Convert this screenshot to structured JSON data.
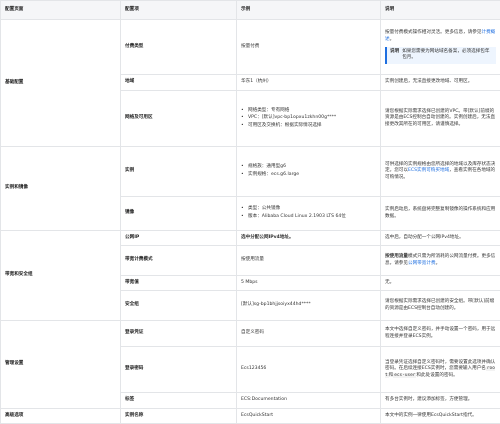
{
  "headers": [
    "配置页面",
    "配置项",
    "示例",
    "说明"
  ],
  "groups": {
    "basic": "基础配置",
    "instance_image": "实例和镜像",
    "bandwidth_security": "带宽和安全组",
    "management": "管理设置",
    "advanced": "高级选项"
  },
  "rows": {
    "billing": {
      "item": "付费类型",
      "example": "按量付费",
      "desc": "按量付费模式操作相对灵活。更多信息，请参见",
      "desc_link": "计费概述",
      "desc_tail": "。",
      "note_label": "说明",
      "note_text": "如果您需要为网站域名备案，必须选择包年包月。"
    },
    "region": {
      "item": "地域",
      "example": "华东1（杭州）",
      "desc": "实例创建后，无法直接更改地域、可用区。"
    },
    "network": {
      "item": "网络及可用区",
      "bullets": [
        "网络类型：专有网络",
        "VPC：[默认]vpc-bp1opxu1zkhn00g****",
        "可用区及交换机：根据实际情况选择"
      ],
      "desc": "请您根据实际需求选择已创建的VPC。带[默认]前缀的资源是由ECS控制台自动创建的。实例创建后，无法直接更改其所在的可用区，请谨慎选择。"
    },
    "instance": {
      "item": "实例",
      "bullets": [
        "规格族：通用型g6",
        "实例规格：ecs.g6.large"
      ],
      "desc_prefix": "可供选择的实例规格由您所选择的地域以及库存状态决定。您可以",
      "desc_link": "ECS实例可购买地域",
      "desc_tail": "，查看实例在各地域的可购情况。"
    },
    "image": {
      "item": "镜像",
      "bullets": [
        "类型：公共镜像",
        "版本：Alibaba Cloud Linux 2.1903 LTS 64位"
      ],
      "desc": "实例启动后，系统盘将完整复制镜像的操作系统和应用数据。"
    },
    "public_ip": {
      "item": "公网IP",
      "example": "选中分配公网IPv4地址。",
      "desc": "选中后，自动分配一个公网IPv4地址。"
    },
    "bandwidth_billing": {
      "item": "带宽计费模式",
      "example": "按使用流量",
      "desc_bold": "按使用流量",
      "desc": "模式只需为所消耗的公网流量付费。更多信息，请参见",
      "desc_link": "公网带宽计费",
      "desc_tail": "。"
    },
    "bandwidth": {
      "item": "带宽值",
      "example": "5 Mbps",
      "desc": "无。"
    },
    "security_group": {
      "item": "安全组",
      "example": "[默认]sg-bp1bhjjsoiyx44hd****",
      "desc": "请您根据实际需求选择已创建的安全组。带[默认]前缀的资源是由ECS控制台自动创建的。"
    },
    "login_credential": {
      "item": "登录凭证",
      "example": "自定义密码",
      "desc": "本文中选择自定义密码，并手动设置一个密码，用于远程连接并登录ECS实例。"
    },
    "login_password": {
      "item": "登录密码",
      "example": "Ecs123456",
      "desc_a": "当登录凭证选择自定义密码时，需要设置此选项并确认密码。在后续连接ECS实例时，您需要输入用户名",
      "code_root": "root",
      "desc_b": "和",
      "code_ecsuser": "ecs-user",
      "desc_c": "和此处设置的密码。"
    },
    "tag": {
      "item": "标签",
      "example": "ECS:Documentation",
      "desc": "有多台实例时，建议添加标签，方便管理。"
    },
    "instance_name": {
      "item": "实例名称",
      "example": "EcsQuickStart",
      "desc": "本文中的实例一律使用EcsQuickStart指代。"
    }
  }
}
